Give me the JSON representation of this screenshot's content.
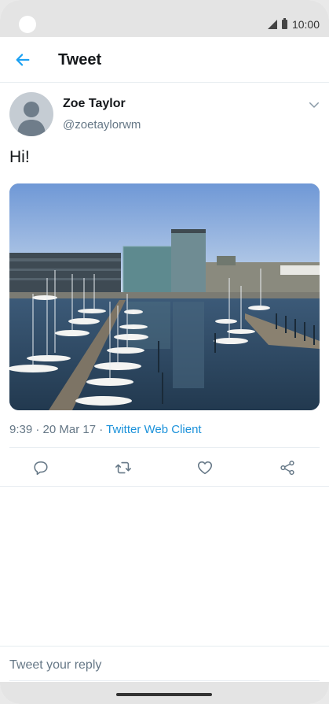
{
  "status_bar": {
    "time": "10:00"
  },
  "appbar": {
    "title": "Tweet"
  },
  "tweet": {
    "user_name": "Zoe Taylor",
    "user_handle": "@zoetaylorwm",
    "text": "Hi!",
    "time": "9:39",
    "date": "20 Mar 17",
    "source": "Twitter Web Client"
  },
  "reply": {
    "placeholder": "Tweet your reply"
  },
  "colors": {
    "accent": "#1da1f2",
    "muted": "#657786",
    "text": "#14171a"
  },
  "icons": [
    "back-arrow-icon",
    "caret-down-icon",
    "reply-icon",
    "retweet-icon",
    "like-icon",
    "share-icon"
  ]
}
